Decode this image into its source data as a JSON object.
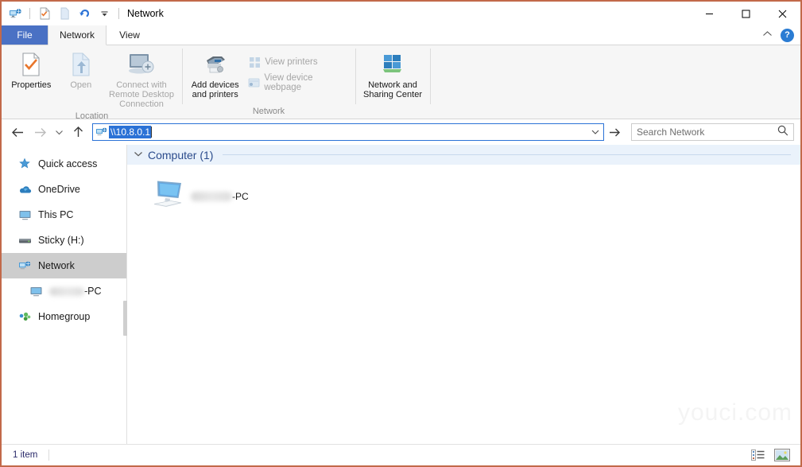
{
  "window": {
    "title": "Network",
    "border_color": "#c2694a",
    "controls": {
      "minimize": "—",
      "maximize": "☐",
      "close": "✕"
    }
  },
  "quick_access_toolbar": {
    "icons": [
      "network-icon",
      "properties-icon",
      "page-icon",
      "undo-icon",
      "customize-chevron-icon"
    ]
  },
  "tabs": [
    {
      "id": "file",
      "label": "File"
    },
    {
      "id": "network",
      "label": "Network"
    },
    {
      "id": "view",
      "label": "View"
    }
  ],
  "tabstrip_right": {
    "collapse_ribbon": "⌃",
    "help": "?"
  },
  "ribbon": {
    "groups": [
      {
        "label": "Location",
        "buttons": [
          {
            "id": "properties",
            "label": "Properties",
            "icon": "properties-icon",
            "disabled": false
          },
          {
            "id": "open",
            "label": "Open",
            "icon": "open-icon",
            "disabled": true
          },
          {
            "id": "connect-rdp",
            "label": "Connect with Remote Desktop Connection",
            "icon": "remote-desktop-icon",
            "disabled": true
          }
        ]
      },
      {
        "label": "Network",
        "buttons": [
          {
            "id": "add-devices",
            "label": "Add devices and printers",
            "icon": "printer-icon",
            "disabled": false
          }
        ],
        "small_buttons": [
          {
            "id": "view-printers",
            "label": "View printers",
            "icon": "view-printers-icon",
            "disabled": true
          },
          {
            "id": "view-device-webpage",
            "label": "View device webpage",
            "icon": "webpage-icon",
            "disabled": true
          }
        ],
        "trailing_buttons": [
          {
            "id": "network-sharing-center",
            "label": "Network and Sharing Center",
            "icon": "network-sharing-icon",
            "disabled": false
          }
        ]
      }
    ]
  },
  "address_bar": {
    "back": "←",
    "forward": "→",
    "recent": "⌄",
    "up": "↑",
    "icon": "network-icon",
    "value": "\\\\10.8.0.1",
    "dropdown": "⌄",
    "go": "→"
  },
  "search": {
    "placeholder": "Search Network",
    "icon": "search-icon"
  },
  "sidebar": {
    "items": [
      {
        "id": "quick-access",
        "label": "Quick access",
        "icon": "star-icon",
        "selected": false,
        "child": false,
        "blurred": false
      },
      {
        "id": "onedrive",
        "label": "OneDrive",
        "icon": "cloud-icon",
        "selected": false,
        "child": false,
        "blurred": false
      },
      {
        "id": "this-pc",
        "label": "This PC",
        "icon": "monitor-icon",
        "selected": false,
        "child": false,
        "blurred": false
      },
      {
        "id": "sticky-h",
        "label": "Sticky (H:)",
        "icon": "drive-icon",
        "selected": false,
        "child": false,
        "blurred": false
      },
      {
        "id": "network",
        "label": "Network",
        "icon": "network-icon",
        "selected": true,
        "child": false,
        "blurred": false
      },
      {
        "id": "network-pc",
        "label": "-PC",
        "icon": "monitor-icon",
        "selected": false,
        "child": true,
        "blurred": true
      },
      {
        "id": "homegroup",
        "label": "Homegroup",
        "icon": "homegroup-icon",
        "selected": false,
        "child": false,
        "blurred": false
      }
    ]
  },
  "main": {
    "group": {
      "title": "Computer (1)",
      "chevron": "⌄"
    },
    "items": [
      {
        "id": "computer-pc",
        "name": "-PC",
        "icon": "computer-icon",
        "blurred": true
      }
    ]
  },
  "watermark": {
    "text": "youci.com"
  },
  "status_bar": {
    "text": "1 item",
    "view_buttons": [
      {
        "id": "details-view",
        "icon": "details-view-icon"
      },
      {
        "id": "large-icons-view",
        "icon": "large-icons-view-icon"
      }
    ]
  }
}
